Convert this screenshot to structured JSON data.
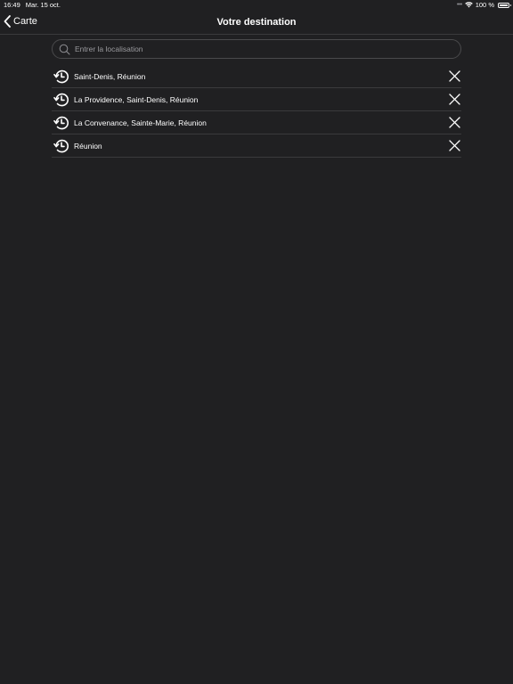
{
  "status_bar": {
    "time": "16:49",
    "date": "Mar. 15 oct.",
    "signal": "•••",
    "battery": "100 %"
  },
  "nav": {
    "back_label": "Carte",
    "title": "Votre destination"
  },
  "search": {
    "placeholder": "Entrer la localisation",
    "value": ""
  },
  "history": {
    "items": [
      {
        "label": "Saint-Denis, Réunion"
      },
      {
        "label": "La Providence, Saint-Denis, Réunion"
      },
      {
        "label": "La Convenance, Sainte-Marie, Réunion"
      },
      {
        "label": "Réunion"
      }
    ]
  },
  "colors": {
    "background": "#202022",
    "separator": "#3a3a3c",
    "text": "#ffffff",
    "placeholder": "#9a9a9e"
  },
  "icons": {
    "back": "chevron-left-icon",
    "search": "search-icon",
    "history": "history-clock-icon",
    "remove": "close-icon",
    "wifi": "wifi-icon",
    "battery": "battery-icon"
  }
}
